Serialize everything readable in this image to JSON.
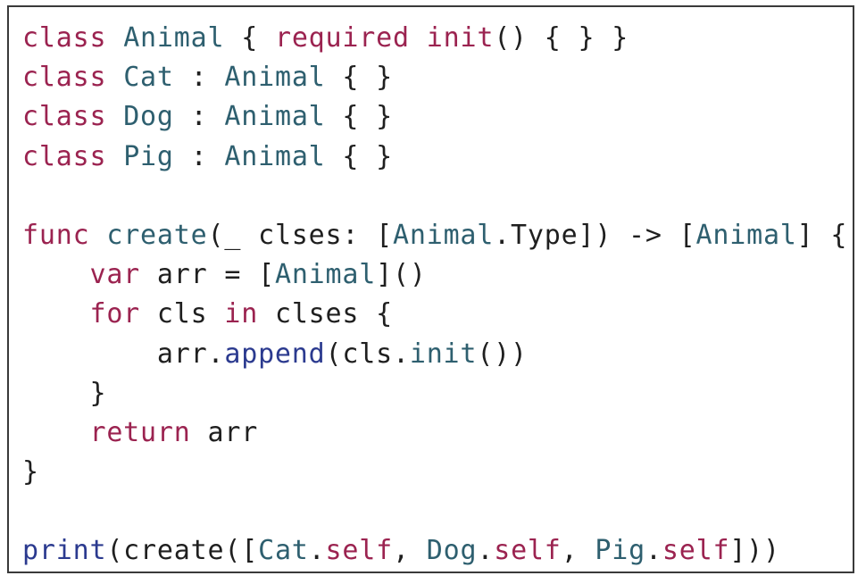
{
  "colors": {
    "keyword": "#9b2350",
    "type": "#2e5f6f",
    "function": "#2b3a8f",
    "plain": "#1f1f1f",
    "border": "#3a3a3a",
    "background": "#ffffff"
  },
  "code": {
    "lines": [
      [
        {
          "text": "class",
          "kind": "kw"
        },
        {
          "text": " ",
          "kind": "pl"
        },
        {
          "text": "Animal",
          "kind": "ty"
        },
        {
          "text": " { ",
          "kind": "pl"
        },
        {
          "text": "required",
          "kind": "kw"
        },
        {
          "text": " ",
          "kind": "pl"
        },
        {
          "text": "init",
          "kind": "kw"
        },
        {
          "text": "() { } }",
          "kind": "pl"
        }
      ],
      [
        {
          "text": "class",
          "kind": "kw"
        },
        {
          "text": " ",
          "kind": "pl"
        },
        {
          "text": "Cat",
          "kind": "ty"
        },
        {
          "text": " : ",
          "kind": "pl"
        },
        {
          "text": "Animal",
          "kind": "ty"
        },
        {
          "text": " { }",
          "kind": "pl"
        }
      ],
      [
        {
          "text": "class",
          "kind": "kw"
        },
        {
          "text": " ",
          "kind": "pl"
        },
        {
          "text": "Dog",
          "kind": "ty"
        },
        {
          "text": " : ",
          "kind": "pl"
        },
        {
          "text": "Animal",
          "kind": "ty"
        },
        {
          "text": " { }",
          "kind": "pl"
        }
      ],
      [
        {
          "text": "class",
          "kind": "kw"
        },
        {
          "text": " ",
          "kind": "pl"
        },
        {
          "text": "Pig",
          "kind": "ty"
        },
        {
          "text": " : ",
          "kind": "pl"
        },
        {
          "text": "Animal",
          "kind": "ty"
        },
        {
          "text": " { }",
          "kind": "pl"
        }
      ],
      [],
      [
        {
          "text": "func",
          "kind": "kw"
        },
        {
          "text": " ",
          "kind": "pl"
        },
        {
          "text": "create",
          "kind": "ty"
        },
        {
          "text": "(_ clses: [",
          "kind": "pl"
        },
        {
          "text": "Animal",
          "kind": "ty"
        },
        {
          "text": ".Type]) -> [",
          "kind": "pl"
        },
        {
          "text": "Animal",
          "kind": "ty"
        },
        {
          "text": "] {",
          "kind": "pl"
        }
      ],
      [
        {
          "text": "    ",
          "kind": "pl"
        },
        {
          "text": "var",
          "kind": "kw"
        },
        {
          "text": " arr = [",
          "kind": "pl"
        },
        {
          "text": "Animal",
          "kind": "ty"
        },
        {
          "text": "]()",
          "kind": "pl"
        }
      ],
      [
        {
          "text": "    ",
          "kind": "pl"
        },
        {
          "text": "for",
          "kind": "kw"
        },
        {
          "text": " cls ",
          "kind": "pl"
        },
        {
          "text": "in",
          "kind": "kw"
        },
        {
          "text": " clses {",
          "kind": "pl"
        }
      ],
      [
        {
          "text": "        arr.",
          "kind": "pl"
        },
        {
          "text": "append",
          "kind": "fn"
        },
        {
          "text": "(cls.",
          "kind": "pl"
        },
        {
          "text": "init",
          "kind": "ty"
        },
        {
          "text": "())",
          "kind": "pl"
        }
      ],
      [
        {
          "text": "    }",
          "kind": "pl"
        }
      ],
      [
        {
          "text": "    ",
          "kind": "pl"
        },
        {
          "text": "return",
          "kind": "kw"
        },
        {
          "text": " arr",
          "kind": "pl"
        }
      ],
      [
        {
          "text": "}",
          "kind": "pl"
        }
      ],
      [],
      [
        {
          "text": "print",
          "kind": "fn"
        },
        {
          "text": "(create([",
          "kind": "pl"
        },
        {
          "text": "Cat",
          "kind": "ty"
        },
        {
          "text": ".",
          "kind": "pl"
        },
        {
          "text": "self",
          "kind": "kw"
        },
        {
          "text": ", ",
          "kind": "pl"
        },
        {
          "text": "Dog",
          "kind": "ty"
        },
        {
          "text": ".",
          "kind": "pl"
        },
        {
          "text": "self",
          "kind": "kw"
        },
        {
          "text": ", ",
          "kind": "pl"
        },
        {
          "text": "Pig",
          "kind": "ty"
        },
        {
          "text": ".",
          "kind": "pl"
        },
        {
          "text": "self",
          "kind": "kw"
        },
        {
          "text": "]))",
          "kind": "pl"
        }
      ]
    ]
  }
}
